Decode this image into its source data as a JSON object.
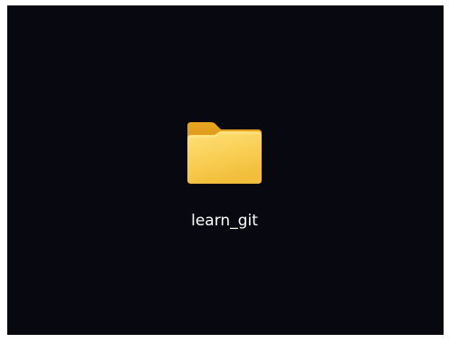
{
  "desktop": {
    "background_color": "#080810",
    "items": [
      {
        "label": "learn_git",
        "icon": "folder-icon",
        "icon_color": "#F8CB4F"
      }
    ]
  }
}
